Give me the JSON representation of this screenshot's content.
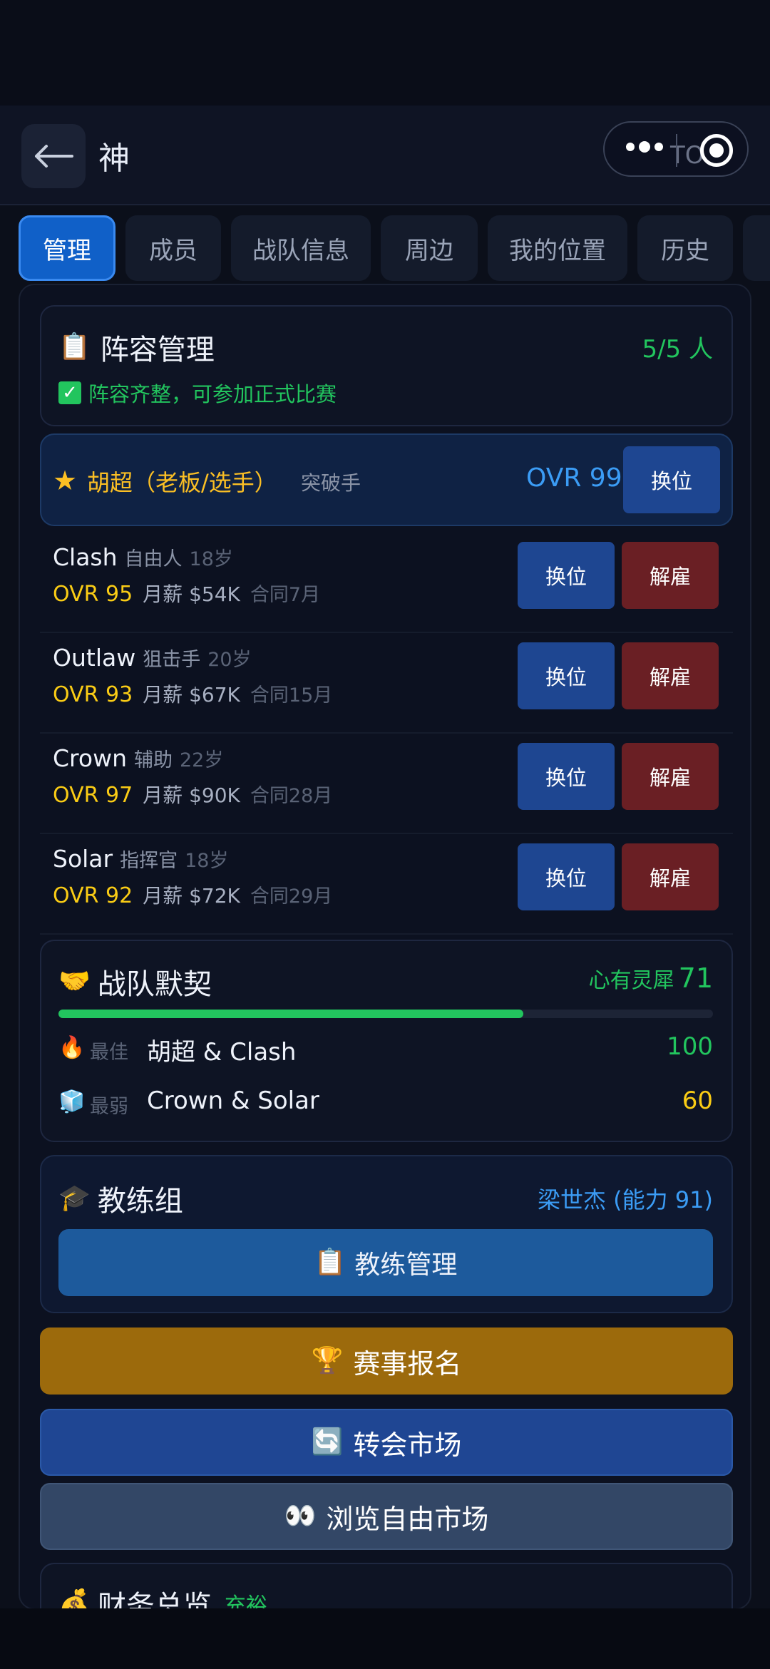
{
  "header": {
    "title": "神",
    "capsule_text": "TO"
  },
  "tabs": [
    "管理",
    "成员",
    "战队信息",
    "周边",
    "我的位置",
    "历史"
  ],
  "lineup": {
    "title": "阵容管理",
    "count": "5/5 人",
    "status": "阵容齐整，可参加正式比赛"
  },
  "captain": {
    "name": "胡超（老板/选手）",
    "role": "突破手",
    "ovr": "OVR 99",
    "swap_label": "换位"
  },
  "players": [
    {
      "name": "Clash",
      "role": "自由人",
      "age": "18岁",
      "ovr": "OVR 95",
      "salary": "月薪 $54K",
      "contract": "合同7月"
    },
    {
      "name": "Outlaw",
      "role": "狙击手",
      "age": "20岁",
      "ovr": "OVR 93",
      "salary": "月薪 $67K",
      "contract": "合同15月"
    },
    {
      "name": "Crown",
      "role": "辅助",
      "age": "22岁",
      "ovr": "OVR 97",
      "salary": "月薪 $90K",
      "contract": "合同28月"
    },
    {
      "name": "Solar",
      "role": "指挥官",
      "age": "18岁",
      "ovr": "OVR 92",
      "salary": "月薪 $72K",
      "contract": "合同29月"
    }
  ],
  "buttons": {
    "swap": "换位",
    "fire": "解雇"
  },
  "chemistry": {
    "title": "战队默契",
    "status_label": "心有灵犀",
    "value": "71",
    "fill_pct": 71,
    "best": {
      "label": "最佳",
      "pair": "胡超 & Clash",
      "value": "100"
    },
    "worst": {
      "label": "最弱",
      "pair": "Crown & Solar",
      "value": "60"
    }
  },
  "coach": {
    "title": "教练组",
    "name": "梁世杰 (能力 91)",
    "manage_label": "教练管理"
  },
  "actions": {
    "event_signup": "赛事报名",
    "transfer_market": "转会市场",
    "free_market": "浏览自由市场"
  },
  "finance": {
    "title": "财务总览",
    "status": "充裕"
  },
  "colors": {
    "accent": "#1060c8",
    "green": "#22c55e",
    "gold": "#facc15",
    "fire": "#6a1f24"
  }
}
